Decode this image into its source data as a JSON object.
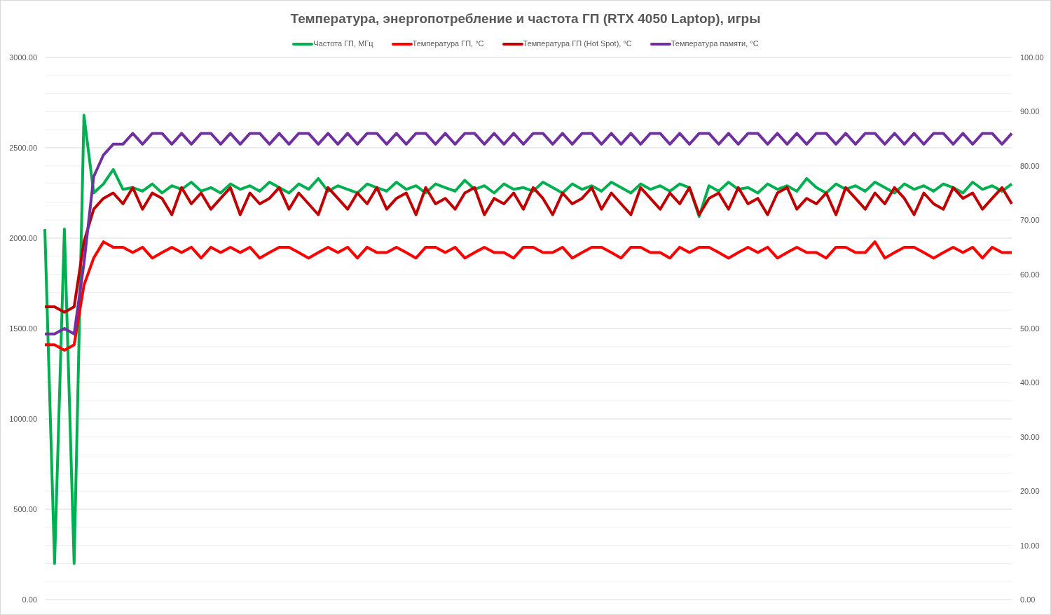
{
  "chart_data": {
    "type": "line",
    "title": "Температура, энергопотребление и частота ГП (RTX 4050 Laptop), игры",
    "legend": "top",
    "grid": true,
    "ylim": [
      0,
      3000
    ],
    "y2lim": [
      0,
      100
    ],
    "yticks": [
      {
        "value": 0,
        "label": "0.00"
      },
      {
        "value": 500,
        "label": "500.00"
      },
      {
        "value": 1000,
        "label": "1000.00"
      },
      {
        "value": 1500,
        "label": "1500.00"
      },
      {
        "value": 2000,
        "label": "2000.00"
      },
      {
        "value": 2500,
        "label": "2500.00"
      },
      {
        "value": 3000,
        "label": "3000.00"
      }
    ],
    "y2ticks": [
      {
        "value": 0,
        "label": "0.00"
      },
      {
        "value": 10,
        "label": "10.00"
      },
      {
        "value": 20,
        "label": "20.00"
      },
      {
        "value": 30,
        "label": "30.00"
      },
      {
        "value": 40,
        "label": "40.00"
      },
      {
        "value": 50,
        "label": "50.00"
      },
      {
        "value": 60,
        "label": "60.00"
      },
      {
        "value": 70,
        "label": "70.00"
      },
      {
        "value": 80,
        "label": "80.00"
      },
      {
        "value": 90,
        "label": "90.00"
      },
      {
        "value": 100,
        "label": "100.00"
      }
    ],
    "series": [
      {
        "name": "Частота ГП, МГц",
        "color": "#00b050",
        "values": [
          2050,
          200,
          2050,
          200,
          2680,
          2250,
          2300,
          2380,
          2270,
          2280,
          2260,
          2300,
          2250,
          2290,
          2270,
          2310,
          2260,
          2280,
          2250,
          2300,
          2270,
          2290,
          2260,
          2310,
          2280,
          2250,
          2300,
          2270,
          2330,
          2260,
          2290,
          2270,
          2250,
          2300,
          2280,
          2260,
          2310,
          2270,
          2290,
          2250,
          2300,
          2280,
          2260,
          2320,
          2270,
          2290,
          2250,
          2300,
          2270,
          2280,
          2260,
          2310,
          2280,
          2250,
          2300,
          2270,
          2290,
          2260,
          2310,
          2280,
          2250,
          2300,
          2270,
          2290,
          2260,
          2300,
          2280,
          2120,
          2290,
          2260,
          2310,
          2270,
          2280,
          2250,
          2300,
          2270,
          2290,
          2260,
          2330,
          2280,
          2250,
          2300,
          2270,
          2290,
          2260,
          2310,
          2280,
          2250,
          2300,
          2270,
          2290,
          2260,
          2300,
          2280,
          2250,
          2310,
          2270,
          2290,
          2260,
          2300
        ]
      },
      {
        "name": "Температура ГП, °C",
        "color": "#ff0000",
        "axis": "y2",
        "values": [
          47,
          47,
          46,
          47,
          58,
          63,
          66,
          65,
          65,
          64,
          65,
          63,
          64,
          65,
          64,
          65,
          63,
          65,
          64,
          65,
          64,
          65,
          63,
          64,
          65,
          65,
          64,
          63,
          64,
          65,
          64,
          65,
          63,
          65,
          64,
          64,
          65,
          64,
          63,
          65,
          65,
          64,
          65,
          63,
          64,
          65,
          64,
          64,
          63,
          65,
          65,
          64,
          64,
          65,
          63,
          64,
          65,
          65,
          64,
          63,
          65,
          65,
          64,
          64,
          63,
          65,
          64,
          65,
          65,
          64,
          63,
          64,
          65,
          64,
          65,
          63,
          64,
          65,
          64,
          64,
          63,
          65,
          65,
          64,
          64,
          66,
          63,
          64,
          65,
          65,
          64,
          63,
          64,
          65,
          64,
          65,
          63,
          65,
          64,
          64
        ]
      },
      {
        "name": "Температура ГП (Hot Spot), °C",
        "color": "#c00000",
        "axis": "y2",
        "values": [
          54,
          54,
          53,
          54,
          66,
          72,
          74,
          75,
          73,
          76,
          72,
          75,
          74,
          71,
          76,
          73,
          75,
          72,
          74,
          76,
          71,
          75,
          73,
          74,
          76,
          72,
          75,
          73,
          71,
          76,
          74,
          72,
          75,
          73,
          76,
          72,
          74,
          75,
          71,
          76,
          73,
          74,
          72,
          75,
          76,
          71,
          74,
          73,
          75,
          72,
          76,
          74,
          71,
          75,
          73,
          74,
          76,
          72,
          75,
          73,
          71,
          76,
          74,
          72,
          75,
          73,
          76,
          71,
          74,
          75,
          72,
          76,
          73,
          74,
          71,
          75,
          76,
          72,
          74,
          73,
          75,
          71,
          76,
          74,
          72,
          75,
          73,
          76,
          74,
          71,
          75,
          73,
          72,
          76,
          74,
          75,
          72,
          74,
          76,
          73
        ]
      },
      {
        "name": "Температура памяти, °C",
        "color": "#7030a0",
        "axis": "y2",
        "values": [
          49,
          49,
          50,
          49,
          62,
          78,
          82,
          84,
          84,
          86,
          84,
          86,
          86,
          84,
          86,
          84,
          86,
          86,
          84,
          86,
          84,
          86,
          86,
          84,
          86,
          84,
          86,
          86,
          84,
          86,
          84,
          86,
          84,
          86,
          86,
          84,
          86,
          84,
          86,
          86,
          84,
          86,
          84,
          86,
          86,
          84,
          86,
          84,
          86,
          84,
          86,
          86,
          84,
          86,
          84,
          86,
          86,
          84,
          86,
          84,
          86,
          84,
          86,
          86,
          84,
          86,
          84,
          86,
          86,
          84,
          86,
          84,
          86,
          86,
          84,
          86,
          84,
          86,
          84,
          86,
          86,
          84,
          86,
          84,
          86,
          86,
          84,
          86,
          84,
          86,
          84,
          86,
          86,
          84,
          86,
          84,
          86,
          86,
          84,
          86
        ]
      }
    ]
  }
}
